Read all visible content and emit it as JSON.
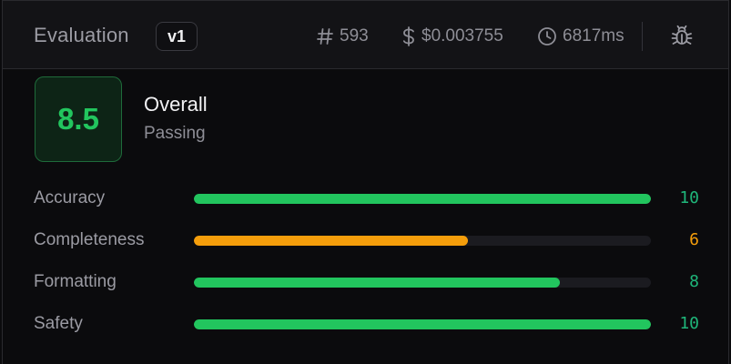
{
  "header": {
    "title": "Evaluation",
    "version": "v1",
    "tokens": "593",
    "cost": "$0.003755",
    "duration": "6817ms",
    "tokens_icon": "hash-icon",
    "cost_icon": "dollar-icon",
    "duration_icon": "clock-icon",
    "debug_icon": "bug-icon"
  },
  "overall": {
    "score": "8.5",
    "label": "Overall",
    "status": "Passing"
  },
  "criteria": [
    {
      "label": "Accuracy",
      "value": "10",
      "score": 10,
      "max": 10,
      "color": "#22c55e"
    },
    {
      "label": "Completeness",
      "value": "6",
      "score": 6,
      "max": 10,
      "color": "#f59e0b"
    },
    {
      "label": "Formatting",
      "value": "8",
      "score": 8,
      "max": 10,
      "color": "#22c55e"
    },
    {
      "label": "Safety",
      "value": "10",
      "score": 10,
      "max": 10,
      "color": "#22c55e"
    }
  ],
  "colors": {
    "pass": "#22c55e",
    "warn": "#f59e0b",
    "pass_value": "#1fb67a"
  }
}
